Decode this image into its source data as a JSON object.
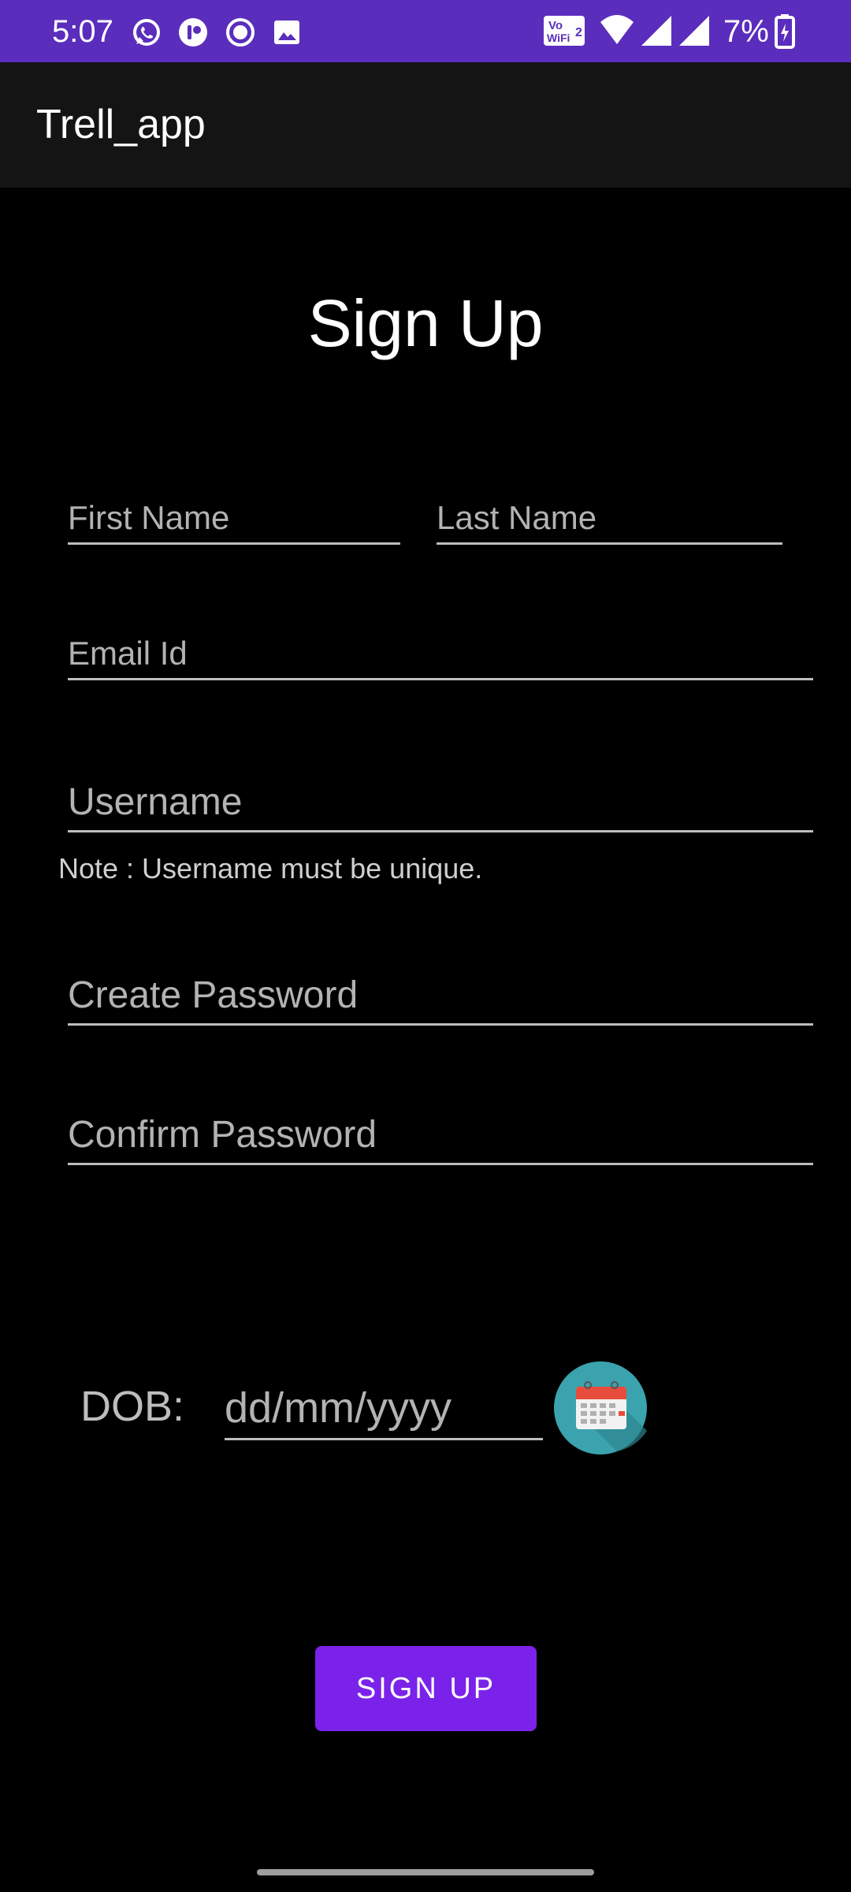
{
  "status_bar": {
    "time": "5:07",
    "battery": "7%",
    "left_icons": [
      "whatsapp-icon",
      "trell-icon",
      "record-icon",
      "gallery-icon"
    ],
    "right_icons": [
      "vowifi-icon",
      "wifi-icon",
      "signal-icon",
      "signal-icon",
      "battery-icon"
    ],
    "background": "#5a2dbd"
  },
  "app_bar": {
    "title": "Trell_app"
  },
  "form": {
    "heading": "Sign Up",
    "first_name_placeholder": "First Name",
    "last_name_placeholder": "Last Name",
    "email_placeholder": "Email Id",
    "username_placeholder": "Username",
    "username_note": "Note : Username must be unique.",
    "create_password_placeholder": "Create Password",
    "confirm_password_placeholder": "Confirm Password",
    "dob_label": "DOB:",
    "dob_placeholder": "dd/mm/yyyy",
    "submit_label": "SIGN UP",
    "accent": "#7b22ea"
  }
}
